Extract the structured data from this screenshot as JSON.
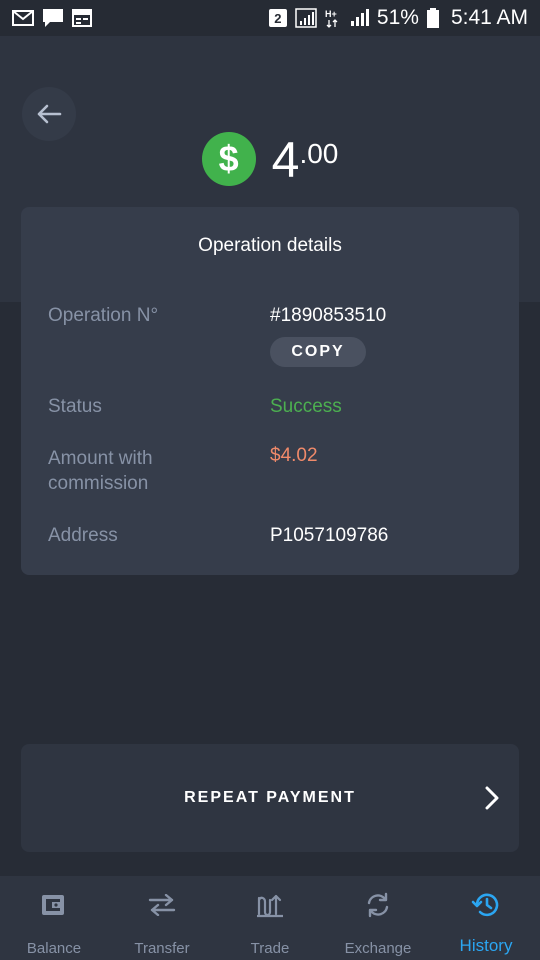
{
  "status_bar": {
    "sim_badge": "2",
    "battery_text": "51%",
    "time": "5:41 AM"
  },
  "header": {
    "amount_integer": "4",
    "amount_decimal": ".00",
    "currency_symbol": "$"
  },
  "details": {
    "title": "Operation details",
    "operation_label": "Operation N°",
    "operation_value": "#1890853510",
    "copy_label": "COPY",
    "status_label": "Status",
    "status_value": "Success",
    "commission_label_line1": "Amount with",
    "commission_label_line2": "commission",
    "commission_value": "$4.02",
    "address_label": "Address",
    "address_value": "P1057109786"
  },
  "actions": {
    "repeat_label": "REPEAT PAYMENT"
  },
  "nav": {
    "items": [
      {
        "label": "Balance",
        "icon": "wallet-icon"
      },
      {
        "label": "Transfer",
        "icon": "transfer-arrows-icon"
      },
      {
        "label": "Trade",
        "icon": "trade-chart-icon"
      },
      {
        "label": "Exchange",
        "icon": "exchange-cycle-icon"
      },
      {
        "label": "History",
        "icon": "history-clock-icon"
      }
    ],
    "active": "History"
  },
  "colors": {
    "success": "#4caf50",
    "commission": "#f08a6a",
    "active_nav": "#2ba6f2",
    "dollar_badge": "#41b24c"
  }
}
